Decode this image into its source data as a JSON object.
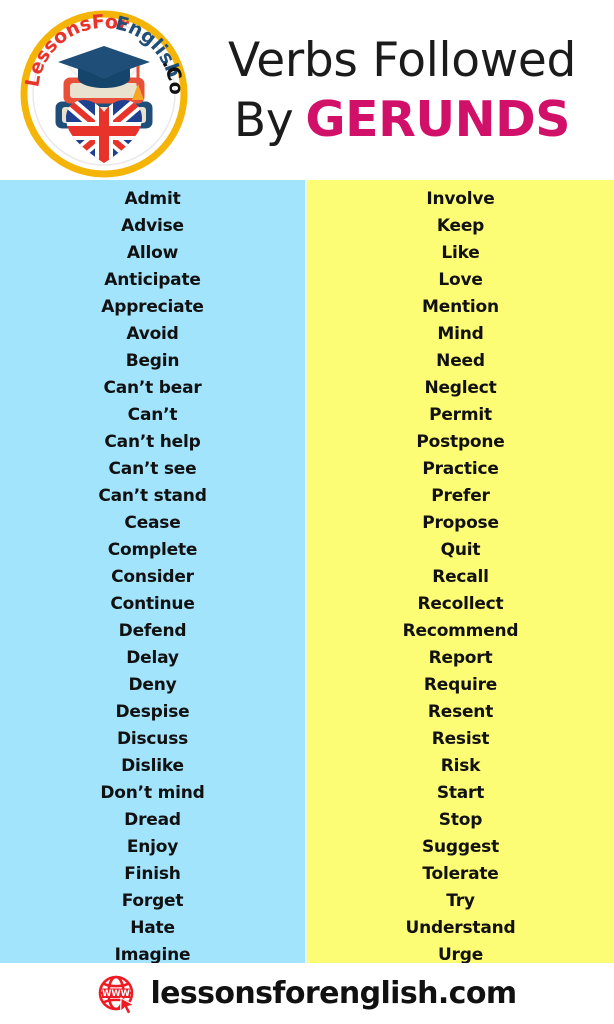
{
  "header": {
    "title_line1": "Verbs Followed",
    "title_by": "By",
    "title_highlight": "GERUNDS",
    "highlight_color": "#d1106a",
    "logo": {
      "name": "lessonsforenglish-badge-logo",
      "text_top": "LessonsFor",
      "text_top_accent": "English",
      "text_bottom": ".Com",
      "ring_color": "#f5b508",
      "accent_blue": "#1f4e79",
      "accent_red": "#e8332a"
    }
  },
  "columns": {
    "left": {
      "background": "#a3e4fd",
      "items": [
        "Admit",
        "Advise",
        "Allow",
        "Anticipate",
        "Appreciate",
        "Avoid",
        "Begin",
        "Can’t bear",
        "Can’t",
        "Can’t help",
        "Can’t see",
        "Can’t stand",
        "Cease",
        "Complete",
        "Consider",
        "Continue",
        "Defend",
        "Delay",
        "Deny",
        "Despise",
        "Discuss",
        "Dislike",
        "Don’t mind",
        "Dread",
        "Enjoy",
        "Finish",
        "Forget",
        "Hate",
        "Imagine"
      ]
    },
    "right": {
      "background": "#fdfd75",
      "items": [
        "Involve",
        "Keep",
        "Like",
        "Love",
        "Mention",
        "Mind",
        "Need",
        "Neglect",
        "Permit",
        "Postpone",
        "Practice",
        "Prefer",
        "Propose",
        "Quit",
        "Recall",
        "Recollect",
        "Recommend",
        "Report",
        "Require",
        "Resent",
        "Resist",
        "Risk",
        "Start",
        "Stop",
        "Suggest",
        "Tolerate",
        "Try",
        "Understand",
        "Urge"
      ]
    }
  },
  "footer": {
    "site": "lessonsforenglish.com",
    "icon": "www-globe-icon",
    "icon_color": "#ee1b24"
  }
}
